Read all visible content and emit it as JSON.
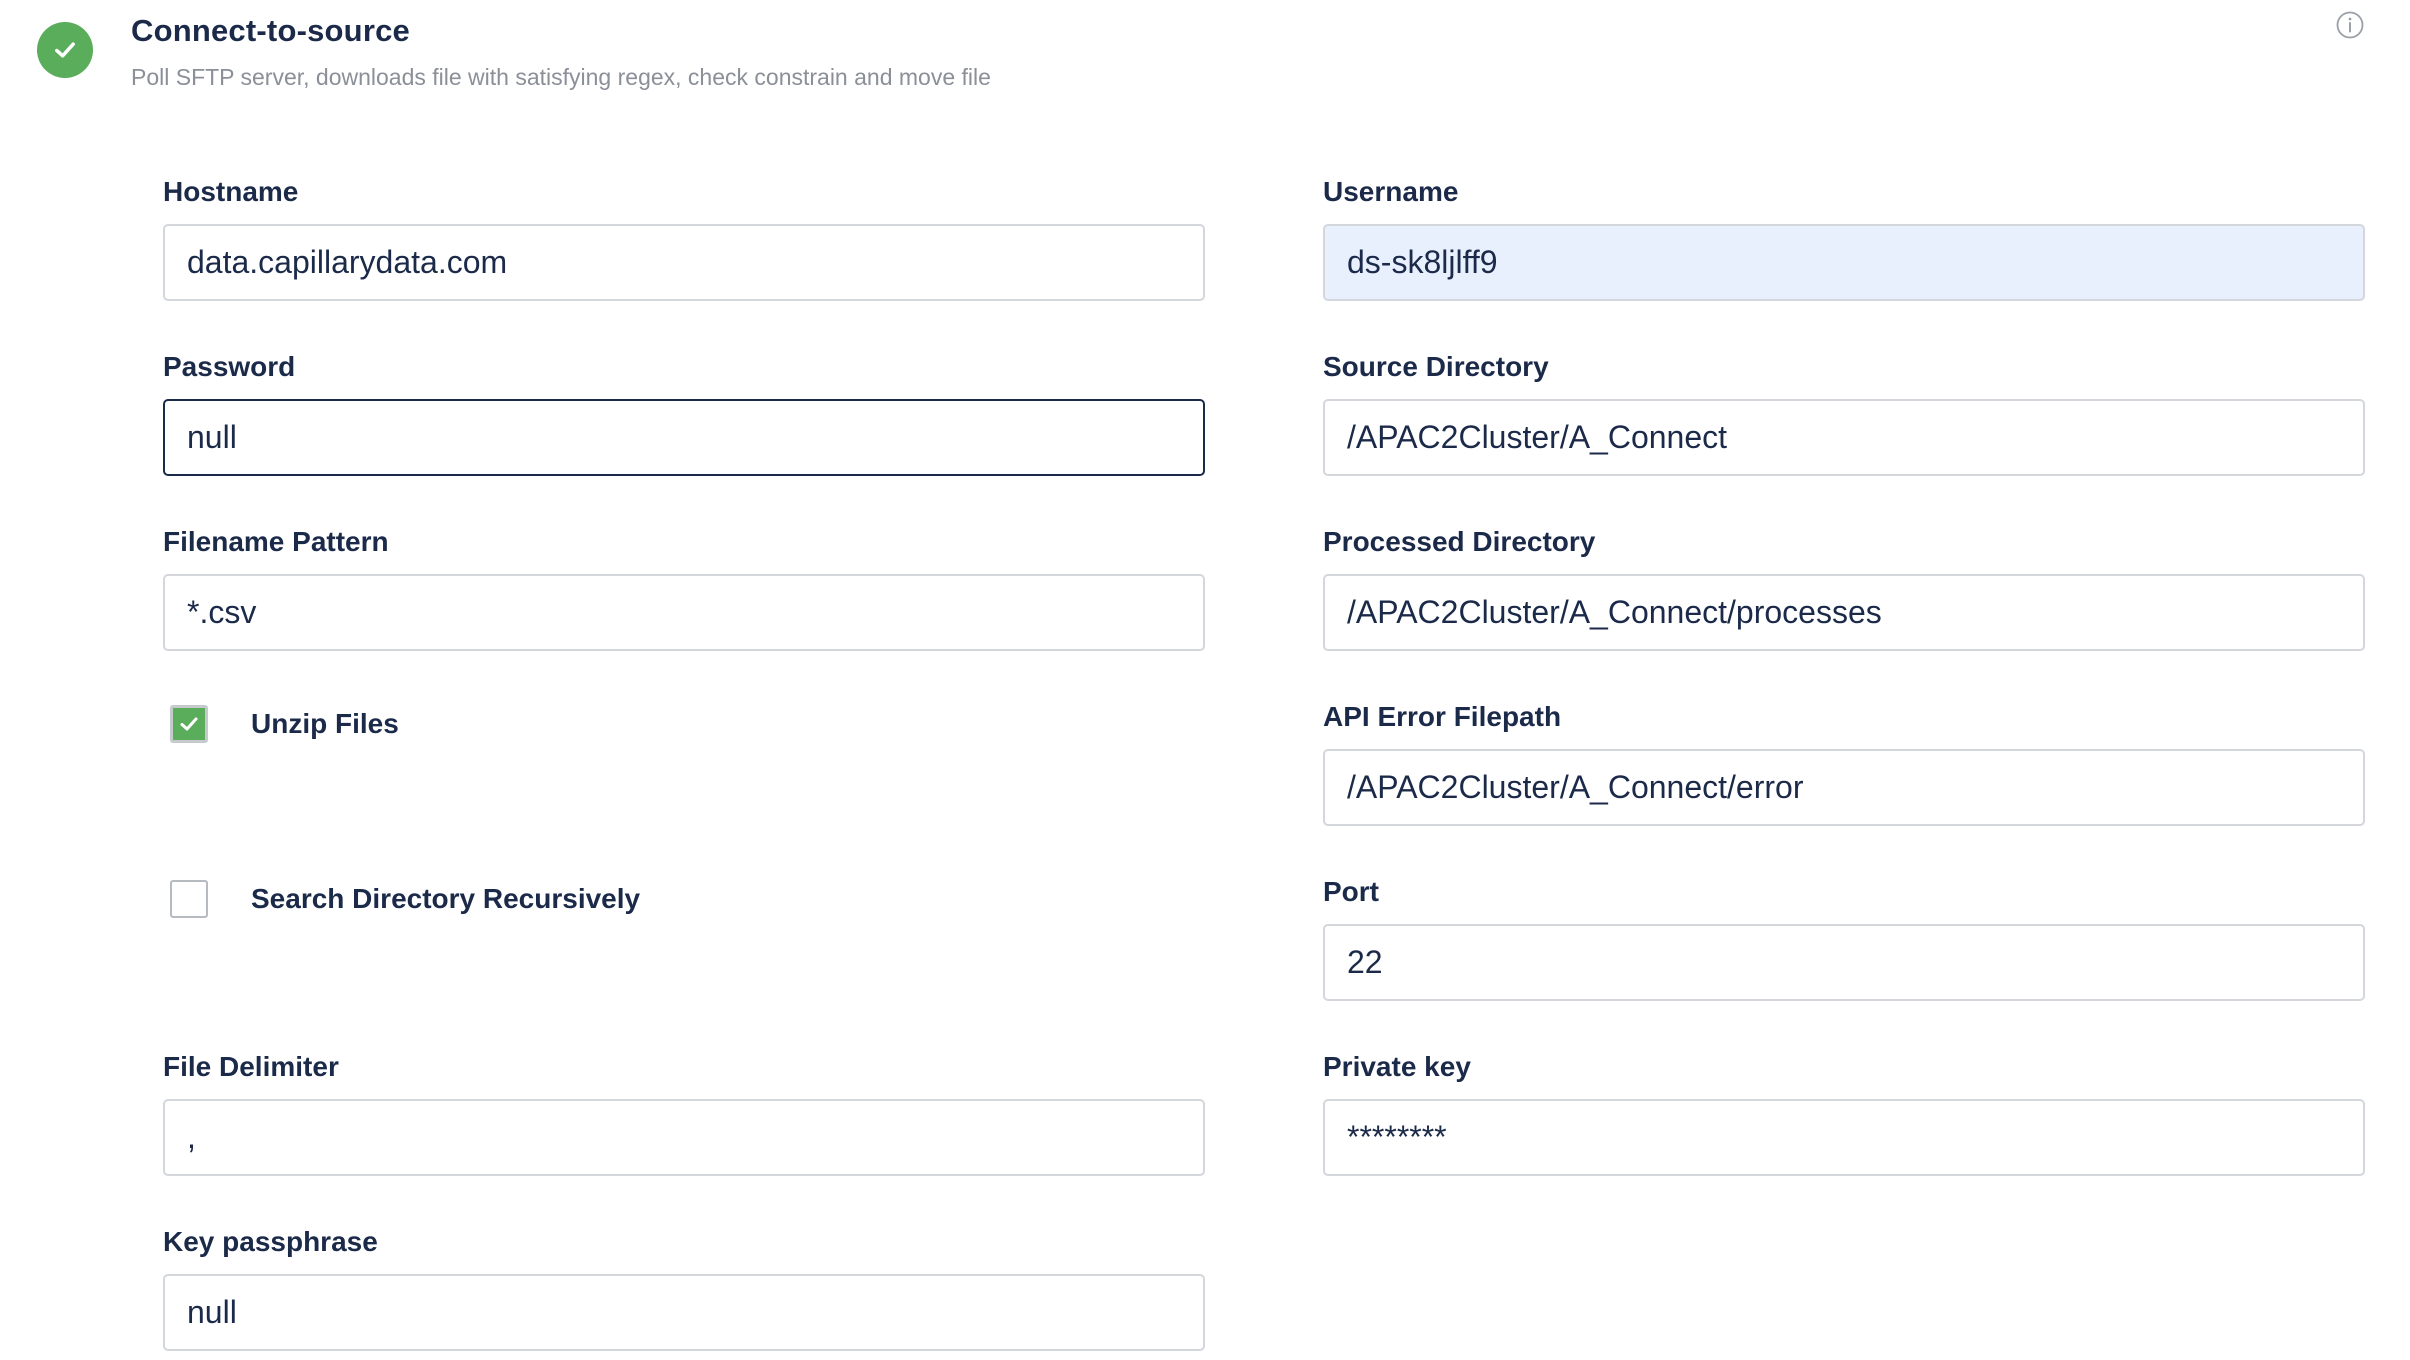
{
  "header": {
    "title": "Connect-to-source",
    "subtitle": "Poll SFTP server, downloads file with satisfying regex, check constrain and move file",
    "status_icon": "check-circle-icon",
    "info_icon": "info-icon"
  },
  "colors": {
    "success": "#5aad5a",
    "text_primary": "#1c2a4a",
    "text_muted": "#8a8f98",
    "input_border": "#d3d6db",
    "autofill_bg": "#e8f0fe"
  },
  "fields": {
    "hostname": {
      "label": "Hostname",
      "value": "data.capillarydata.com"
    },
    "username": {
      "label": "Username",
      "value": "ds-sk8ljlff9"
    },
    "password": {
      "label": "Password",
      "value": "null"
    },
    "source_directory": {
      "label": "Source Directory",
      "value": "/APAC2Cluster/A_Connect"
    },
    "filename_pattern": {
      "label": "Filename Pattern",
      "value": "*.csv"
    },
    "processed_directory": {
      "label": "Processed Directory",
      "value": "/APAC2Cluster/A_Connect/processes"
    },
    "api_error_filepath": {
      "label": "API Error Filepath",
      "value": "/APAC2Cluster/A_Connect/error"
    },
    "port": {
      "label": "Port",
      "value": "22"
    },
    "file_delimiter": {
      "label": "File Delimiter",
      "value": ","
    },
    "private_key": {
      "label": "Private key",
      "value": "********"
    },
    "key_passphrase": {
      "label": "Key passphrase",
      "value": "null"
    }
  },
  "checkboxes": {
    "unzip_files": {
      "label": "Unzip Files",
      "checked": true
    },
    "search_recursively": {
      "label": "Search Directory Recursively",
      "checked": false
    }
  }
}
